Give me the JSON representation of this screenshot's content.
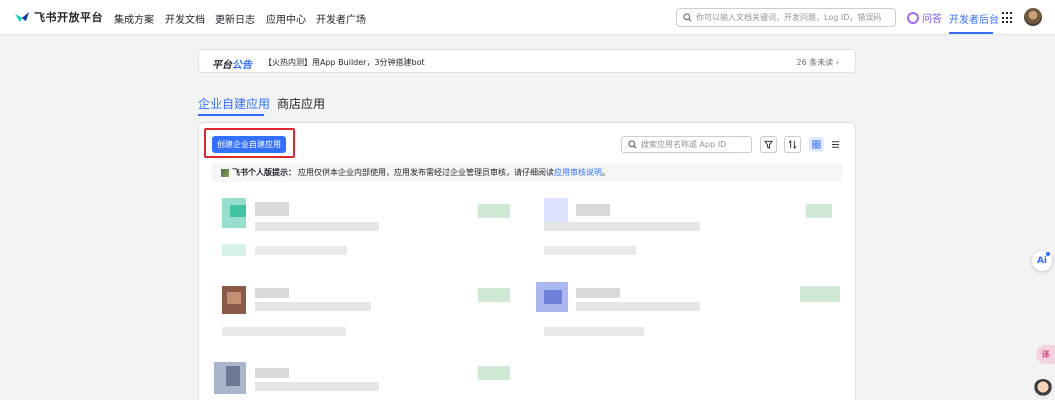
{
  "nav": {
    "logo": "飞书开放平台",
    "items": [
      "集成方案",
      "开发文档",
      "更新日志",
      "应用中心",
      "开发者广场"
    ],
    "search_placeholder": "你可以输入文档关键词，开发问题，Log ID，错误码",
    "ask": "问答",
    "console": "开发者后台"
  },
  "announcement": {
    "title_a": "平台",
    "title_b": "公告",
    "text": "【火热内测】用App Builder，3分钟搭建bot",
    "unread": "26 条未读 ›"
  },
  "tabs": [
    "企业自建应用",
    "商店应用"
  ],
  "toolbar": {
    "create_label": "创建企业自建应用",
    "search_placeholder": "搜索应用名称或 App ID"
  },
  "tip": {
    "title": "飞书个人版提示：",
    "text": "应用仅供本企业内部使用，应用发布需经过企业管理员审核，请仔细阅读",
    "link": "应用审核说明",
    "end": "。"
  },
  "floaters": {
    "ai": "Ai",
    "translate": "译"
  },
  "colors": {
    "accent": "#3370ff",
    "highlight": "#d9262f"
  }
}
